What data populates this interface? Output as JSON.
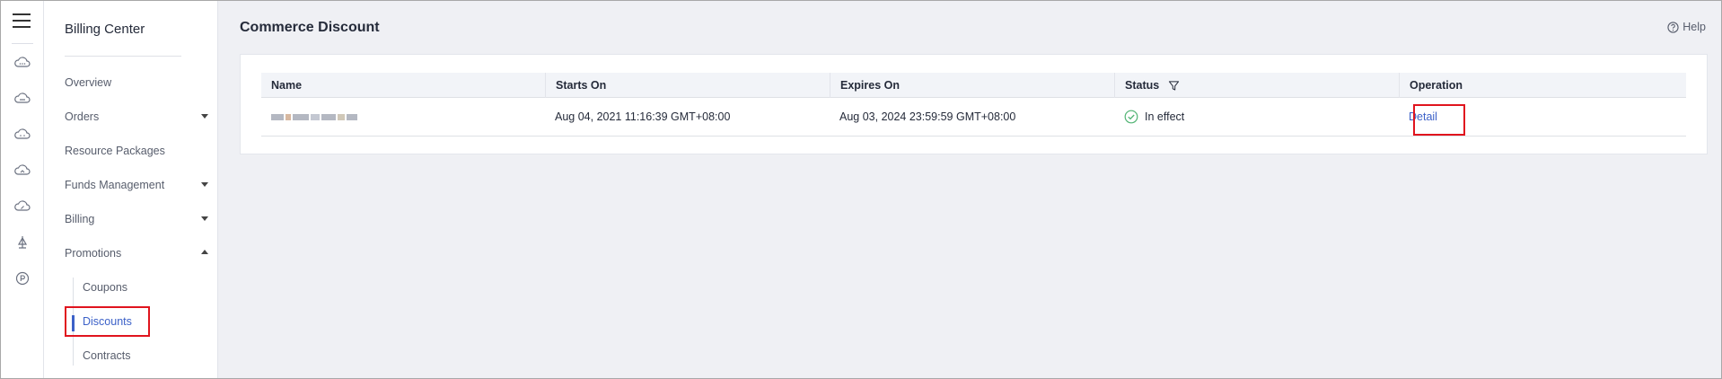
{
  "rail": {
    "icons": [
      "menu-icon",
      "cloud-icon",
      "cloud-icon",
      "cloud-icon",
      "cloud-icon",
      "cloud-icon",
      "balance-icon",
      "promotion-icon"
    ]
  },
  "sidebar": {
    "title": "Billing Center",
    "items": [
      {
        "label": "Overview",
        "expandable": false
      },
      {
        "label": "Orders",
        "expandable": true,
        "expanded": false
      },
      {
        "label": "Resource Packages",
        "expandable": false
      },
      {
        "label": "Funds Management",
        "expandable": true,
        "expanded": false
      },
      {
        "label": "Billing",
        "expandable": true,
        "expanded": false
      },
      {
        "label": "Promotions",
        "expandable": true,
        "expanded": true
      }
    ],
    "subitems": [
      {
        "label": "Coupons",
        "active": false
      },
      {
        "label": "Discounts",
        "active": true
      },
      {
        "label": "Contracts",
        "active": false
      }
    ]
  },
  "page": {
    "title": "Commerce Discount",
    "help_label": "Help"
  },
  "table": {
    "columns": [
      "Name",
      "Starts On",
      "Expires On",
      "Status",
      "Operation"
    ],
    "rows": [
      {
        "name": "",
        "starts_on": "Aug 04, 2021 11:16:39 GMT+08:00",
        "expires_on": "Aug 03, 2024 23:59:59 GMT+08:00",
        "status": "In effect",
        "operation": "Detail"
      }
    ]
  },
  "colors": {
    "accent": "#3c61c8",
    "highlight": "#e0141e",
    "status_ok": "#50b373"
  }
}
